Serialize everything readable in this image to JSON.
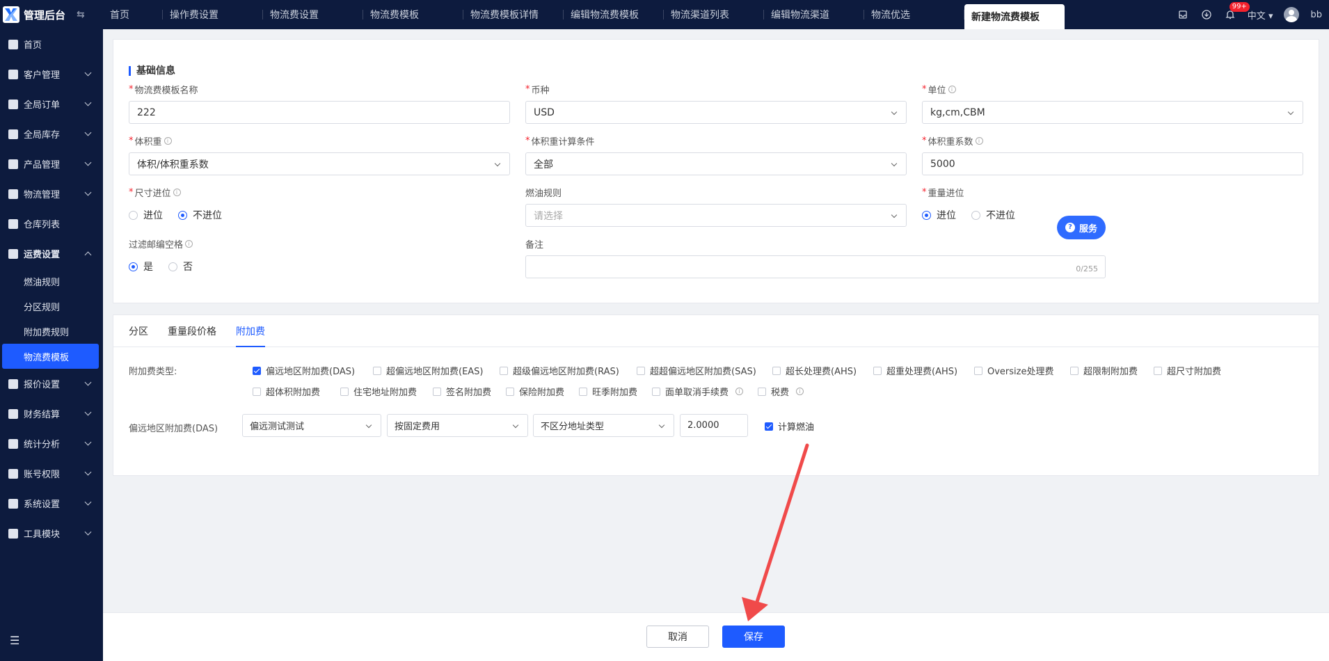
{
  "app": {
    "title": "管理后台"
  },
  "tabs": [
    {
      "label": "首页"
    },
    {
      "label": "操作费设置"
    },
    {
      "label": "物流费设置"
    },
    {
      "label": "物流费模板"
    },
    {
      "label": "物流费模板详情"
    },
    {
      "label": "编辑物流费模板"
    },
    {
      "label": "物流渠道列表"
    },
    {
      "label": "编辑物流渠道"
    },
    {
      "label": "物流优选"
    },
    {
      "label": "新建物流费模板",
      "active": true
    }
  ],
  "topbar": {
    "notification_count": "99+",
    "language": "中文",
    "username": "bb"
  },
  "sidebar": {
    "items": [
      {
        "label": "首页",
        "icon": "home-icon"
      },
      {
        "label": "客户管理",
        "icon": "user-icon"
      },
      {
        "label": "全局订单",
        "icon": "order-icon"
      },
      {
        "label": "全局库存",
        "icon": "warehouse-icon"
      },
      {
        "label": "产品管理",
        "icon": "box-icon"
      },
      {
        "label": "物流管理",
        "icon": "truck-icon"
      },
      {
        "label": "仓库列表",
        "icon": "house-icon"
      },
      {
        "label": "运费设置",
        "icon": "package-icon",
        "expanded": true
      }
    ],
    "sub_items": [
      {
        "label": "燃油规则"
      },
      {
        "label": "分区规则"
      },
      {
        "label": "附加费规则"
      },
      {
        "label": "物流费模板",
        "active": true
      }
    ],
    "items_after": [
      {
        "label": "报价设置",
        "icon": "quote-icon"
      },
      {
        "label": "财务结算",
        "icon": "money-icon"
      },
      {
        "label": "统计分析",
        "icon": "chart-icon"
      },
      {
        "label": "账号权限",
        "icon": "org-icon"
      },
      {
        "label": "系统设置",
        "icon": "gear-icon"
      },
      {
        "label": "工具模块",
        "icon": "wrench-icon"
      }
    ]
  },
  "basic_info": {
    "title": "基础信息",
    "template_name": {
      "label": "物流费模板名称",
      "value": "222"
    },
    "currency": {
      "label": "币种",
      "value": "USD"
    },
    "unit": {
      "label": "单位",
      "value": "kg,cm,CBM"
    },
    "volume_weight": {
      "label": "体积重",
      "value": "体积/体积重系数"
    },
    "volume_condition": {
      "label": "体积重计算条件",
      "value": "全部"
    },
    "volume_factor": {
      "label": "体积重系数",
      "value": "5000"
    },
    "size_round": {
      "label": "尺寸进位",
      "opt1": "进位",
      "opt2": "不进位"
    },
    "fuel_rule": {
      "label": "燃油规则",
      "placeholder": "请选择"
    },
    "weight_round": {
      "label": "重量进位",
      "opt1": "进位",
      "opt2": "不进位"
    },
    "filter_zip": {
      "label": "过滤邮编空格",
      "opt1": "是",
      "opt2": "否"
    },
    "remark": {
      "label": "备注",
      "counter": "0/255"
    },
    "service_button": "服务"
  },
  "fee_section": {
    "tabs": [
      "分区",
      "重量段价格",
      "附加费"
    ],
    "fee_type_label": "附加费类型:",
    "row1": [
      {
        "label": "偏远地区附加费(DAS)",
        "checked": true
      },
      {
        "label": "超偏远地区附加费(EAS)",
        "checked": false
      },
      {
        "label": "超级偏远地区附加费(RAS)",
        "checked": false
      },
      {
        "label": "超超偏远地区附加费(SAS)",
        "checked": false
      },
      {
        "label": "超长处理费(AHS)",
        "checked": false
      },
      {
        "label": "超重处理费(AHS)",
        "checked": false
      },
      {
        "label": "Oversize处理费",
        "checked": false
      },
      {
        "label": "超限制附加费",
        "checked": false
      },
      {
        "label": "超尺寸附加费",
        "checked": false
      }
    ],
    "row2": [
      {
        "label": "超体积附加费",
        "checked": false
      },
      {
        "label": "住宅地址附加费",
        "checked": false
      },
      {
        "label": "签名附加费",
        "checked": false
      },
      {
        "label": "保险附加费",
        "checked": false
      },
      {
        "label": "旺季附加费",
        "checked": false
      },
      {
        "label": "面单取消手续费",
        "checked": false
      },
      {
        "label": "税费",
        "checked": false
      }
    ],
    "das_label": "偏远地区附加费(DAS)",
    "das_select1": "偏远测试测试",
    "das_select2": "按固定费用",
    "das_select3": "不区分地址类型",
    "das_value": "2.0000",
    "fuel_checkbox": "计算燃油"
  },
  "footer": {
    "cancel": "取消",
    "save": "保存"
  },
  "colors": {
    "primary": "#1e5bff",
    "nav_bg": "#0d1b3e",
    "arrow": "#f04a4a"
  }
}
